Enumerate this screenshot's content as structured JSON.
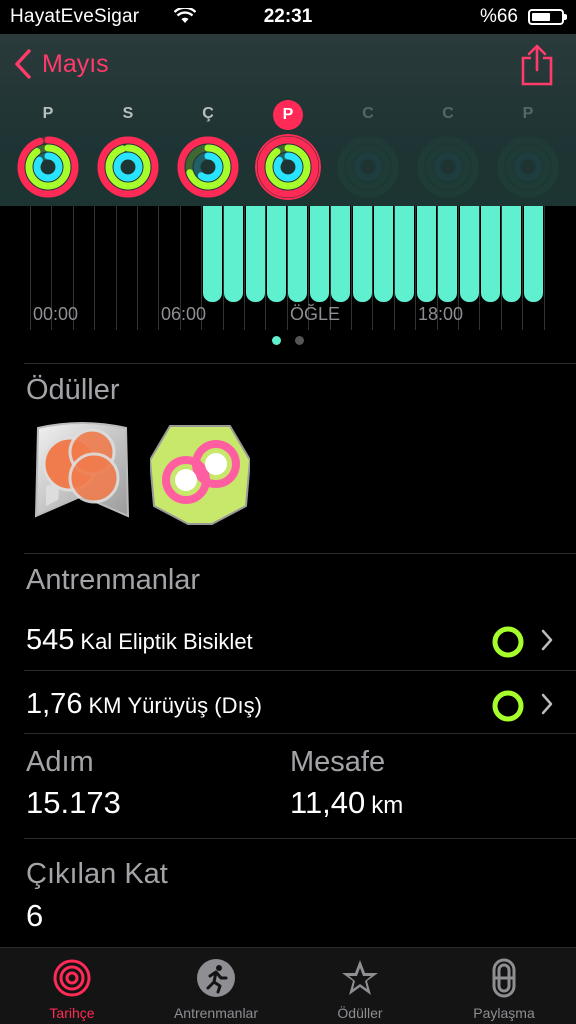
{
  "status": {
    "carrier": "HayatEveSigar",
    "time": "22:31",
    "battery_pct": "%66",
    "battery_level": 0.66
  },
  "nav": {
    "back_label": "Mayıs"
  },
  "week": {
    "days": [
      {
        "letter": "P",
        "move": 0.95,
        "exercise": 0.9,
        "stand": 0.85,
        "state": "past"
      },
      {
        "letter": "S",
        "move": 1.0,
        "exercise": 0.95,
        "stand": 1.0,
        "state": "past"
      },
      {
        "letter": "Ç",
        "move": 1.0,
        "exercise": 0.7,
        "stand": 0.6,
        "state": "past"
      },
      {
        "letter": "P",
        "move": 1.0,
        "exercise": 0.9,
        "stand": 0.85,
        "state": "today"
      },
      {
        "letter": "C",
        "move": 0,
        "exercise": 0,
        "stand": 0,
        "state": "future"
      },
      {
        "letter": "C",
        "move": 0,
        "exercise": 0,
        "stand": 0,
        "state": "future"
      },
      {
        "letter": "P",
        "move": 0,
        "exercise": 0,
        "stand": 0,
        "state": "future"
      }
    ]
  },
  "stand_chart": {
    "ticks": [
      "00:00",
      "06:00",
      "ÖĞLE",
      "18:00"
    ],
    "hours_active": [
      8,
      9,
      10,
      11,
      12,
      13,
      14,
      15,
      16,
      17,
      18,
      19,
      20,
      21,
      22,
      23
    ]
  },
  "awards": {
    "title": "Ödüller"
  },
  "workouts": {
    "title": "Antrenmanlar",
    "items": [
      {
        "value": "545",
        "unit": "Kal",
        "name": "Eliptik Bisiklet"
      },
      {
        "value": "1,76",
        "unit": "KM",
        "name": "Yürüyüş (Dış)"
      }
    ]
  },
  "stats": {
    "steps_label": "Adım",
    "steps_value": "15.173",
    "distance_label": "Mesafe",
    "distance_value": "11,40",
    "distance_unit": "km",
    "floors_label": "Çıkılan Kat",
    "floors_value": "6"
  },
  "tabs": [
    {
      "label": "Tarihçe",
      "icon": "history-rings-icon",
      "active": true
    },
    {
      "label": "Antrenmanlar",
      "icon": "workout-runner-icon",
      "active": false
    },
    {
      "label": "Ödüller",
      "icon": "awards-star-icon",
      "active": false
    },
    {
      "label": "Paylaşma",
      "icon": "sharing-icon",
      "active": false
    }
  ],
  "colors": {
    "accent": "#ff2a55",
    "move": "#ff2a55",
    "exercise": "#a6ff2a",
    "stand": "#2ae3ff",
    "stand_bar": "#5ff0cf"
  }
}
